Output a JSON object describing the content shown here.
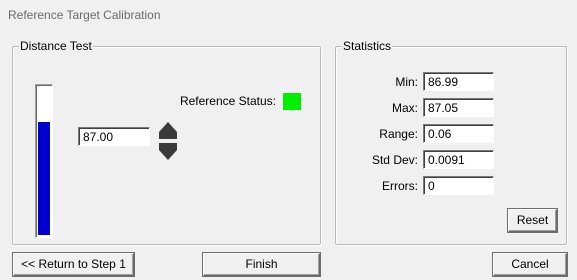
{
  "window": {
    "title": "Reference Target Calibration"
  },
  "distance_test": {
    "legend": "Distance Test",
    "gauge_level_percent": 77,
    "distance_value": "87.00",
    "reference_status_label": "Reference Status:",
    "reference_status_color": "#00ee00",
    "gauge_color": "#0000cc"
  },
  "statistics": {
    "legend": "Statistics",
    "rows": [
      {
        "label": "Min:",
        "value": "86.99"
      },
      {
        "label": "Max:",
        "value": "87.05"
      },
      {
        "label": "Range:",
        "value": "0.06"
      },
      {
        "label": "Std Dev:",
        "value": "0.0091"
      },
      {
        "label": "Errors:",
        "value": "0"
      }
    ],
    "reset_label": "Reset"
  },
  "buttons": {
    "return_label": "<< Return to Step 1",
    "finish_label": "Finish",
    "cancel_label": "Cancel"
  },
  "icons": {
    "stepper": "up-down-arrows-icon"
  }
}
